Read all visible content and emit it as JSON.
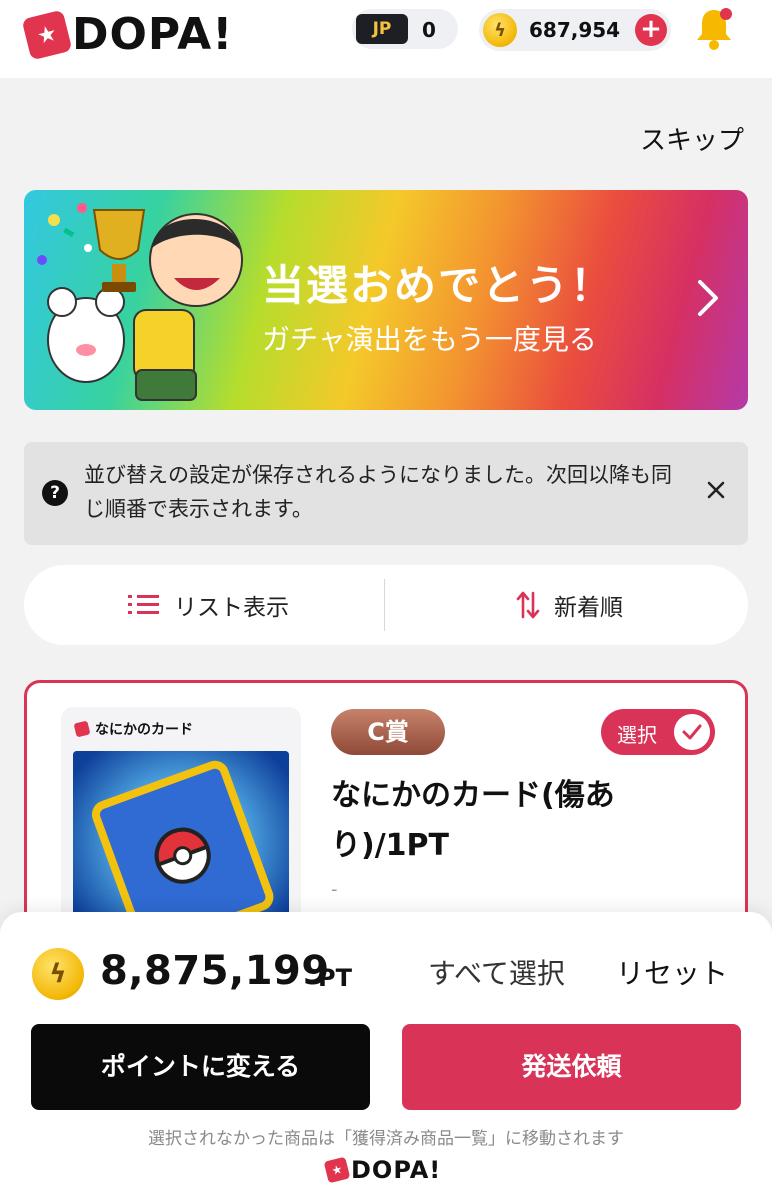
{
  "header": {
    "logo_text": "DOPA!",
    "jp_label": "JP",
    "jp_value": "0",
    "coin_balance": "687,954",
    "add_label": "+"
  },
  "skip_label": "スキップ",
  "banner": {
    "title": "当選おめでとう！",
    "subtitle": "ガチャ演出をもう一度見る"
  },
  "notice": {
    "icon_label": "?",
    "text": "並び替えの設定が保存されるようになりました。次回以降も同じ順番で表示されます。"
  },
  "view_toggle": {
    "list_label": "リスト表示",
    "sort_label": "新着順"
  },
  "card": {
    "image_label": "なにかのカード",
    "prize": "C賞",
    "select_label": "選択",
    "title": "なにかのカード(傷あり)/1PT",
    "dash": "-"
  },
  "sheet": {
    "total_points": "8,875,199",
    "unit": "PT",
    "select_all_label": "すべて選択",
    "reset_label": "リセット",
    "convert_label": "ポイントに変える",
    "ship_label": "発送依頼",
    "footnote": "選択されなかった商品は「獲得済み商品一覧」に移動されます",
    "footer_logo": "DOPA!"
  },
  "colors": {
    "brand": "#e0344f",
    "accent": "#d93458",
    "coin": "#f2b705"
  },
  "icons": [
    "logo-mark-icon",
    "ticket-icon",
    "coin-icon",
    "plus-icon",
    "bell-icon",
    "chevron-right-icon",
    "help-icon",
    "close-icon",
    "list-icon",
    "sort-icon",
    "check-icon"
  ]
}
